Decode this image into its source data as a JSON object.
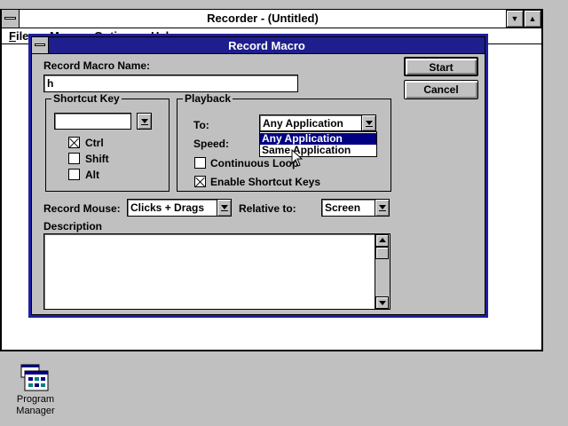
{
  "recorder": {
    "title": "Recorder - (Untitled)",
    "menu": [
      "File",
      "Macro",
      "Options",
      "Help"
    ]
  },
  "dialog": {
    "title": "Record Macro",
    "name_label": "Record Macro Name:",
    "name_value": "h",
    "start_label": "Start",
    "cancel_label": "Cancel",
    "shortcut": {
      "group_label": "Shortcut Key",
      "key_value": "",
      "ctrl_label": "Ctrl",
      "ctrl_checked": true,
      "shift_label": "Shift",
      "shift_checked": false,
      "alt_label": "Alt",
      "alt_checked": false
    },
    "playback": {
      "group_label": "Playback",
      "to_label": "To:",
      "to_value": "Any Application",
      "to_options": [
        "Any Application",
        "Same Application"
      ],
      "speed_label": "Speed:",
      "loop_label": "Continuous Loop",
      "loop_checked": false,
      "enable_label": "Enable Shortcut Keys",
      "enable_checked": true
    },
    "record_mouse_label": "Record Mouse:",
    "record_mouse_value": "Clicks + Drags",
    "relative_label": "Relative to:",
    "relative_value": "Screen",
    "description_label": "Description",
    "description_value": ""
  },
  "desktop": {
    "program_manager_label": "Program Manager"
  }
}
